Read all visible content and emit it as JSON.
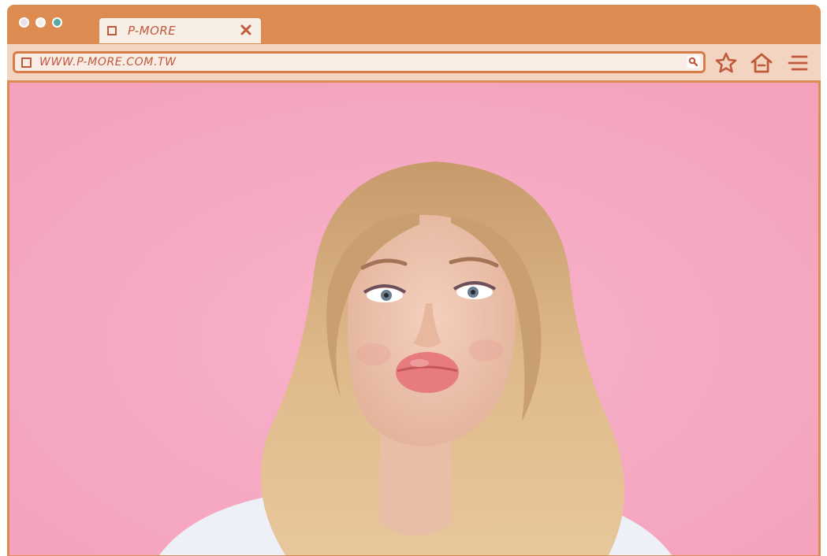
{
  "browser": {
    "tab": {
      "title": "P-MORE",
      "icon": "square-icon",
      "close_icon": "close-icon"
    },
    "address_bar": {
      "url": "WWW.P-MORE.COM.TW",
      "search_icon": "search-icon"
    },
    "toolbar_icons": [
      "star-icon",
      "home-icon",
      "menu-icon"
    ],
    "traffic_lights": [
      "gray",
      "white",
      "teal"
    ]
  },
  "colors": {
    "frame": "#dc8c51",
    "toolbar": "#f3d4c0",
    "text_accent": "#c05a3d",
    "content_background": "#f6a9c2"
  },
  "content": {
    "image": "portrait of a blonde woman blowing a kiss against a pink background"
  }
}
